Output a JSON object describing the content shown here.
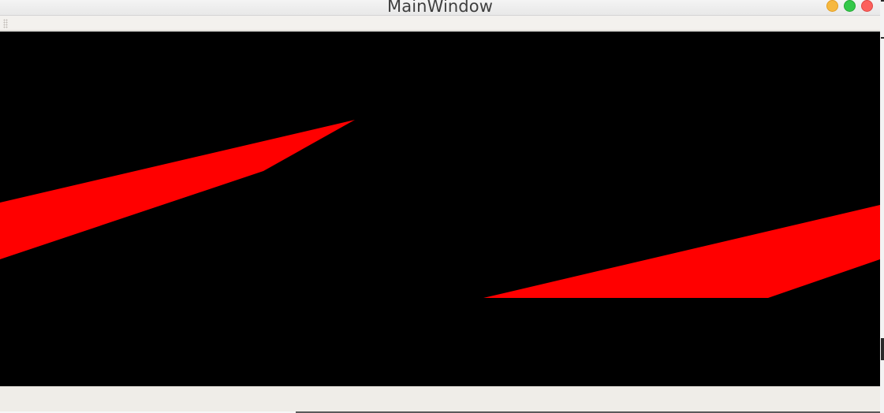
{
  "window": {
    "title": "MainWindow"
  },
  "icons": {
    "minimize": "minimize-window-icon",
    "maximize": "maximize-window-icon",
    "close": "close-window-icon",
    "toolbar_grip": "toolbar-grip-icon"
  },
  "colors": {
    "canvas_background": "#000000",
    "shape_fill": "#ff0000",
    "minimize_button": "#f6b83f",
    "maximize_button": "#34c84a",
    "close_button": "#fc605c"
  }
}
